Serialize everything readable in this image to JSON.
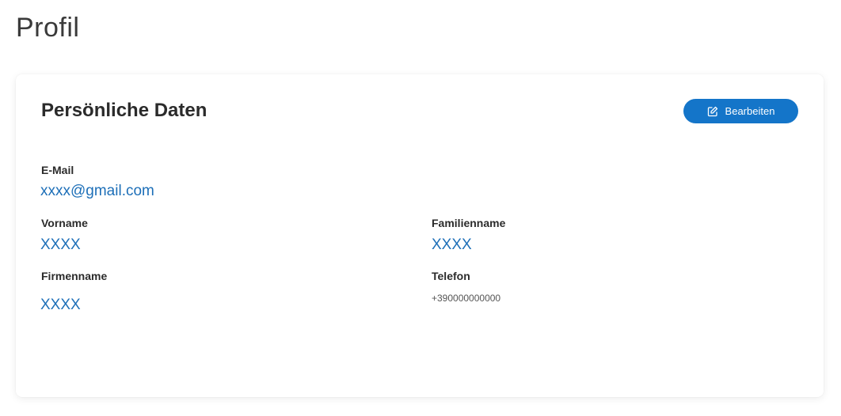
{
  "page": {
    "title": "Profil"
  },
  "card": {
    "title": "Persönliche Daten",
    "edit_label": "Bearbeiten",
    "accent_color": "#1475c9",
    "edit_icon": "edit-icon"
  },
  "fields": {
    "email": {
      "label": "E-Mail",
      "value": "xxxx@gmail.com"
    },
    "first_name": {
      "label": "Vorname",
      "value": "XXXX"
    },
    "last_name": {
      "label": "Familienname",
      "value": "XXXX"
    },
    "company": {
      "label": "Firmenname",
      "value": "XXXX"
    },
    "phone": {
      "label": "Telefon",
      "value": "+390000000000"
    }
  }
}
